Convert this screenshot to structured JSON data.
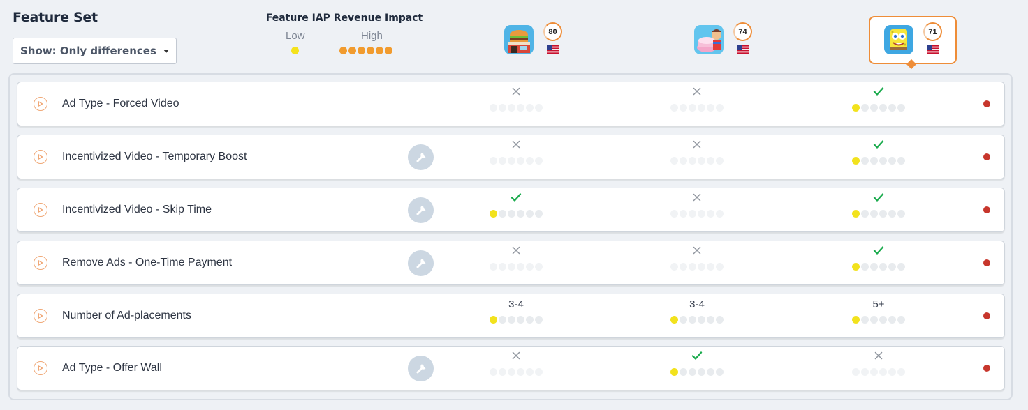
{
  "header": {
    "title": "Feature Set",
    "filter_label": "Show: Only differences"
  },
  "legend": {
    "title": "Feature IAP Revenue Impact",
    "low_label": "Low",
    "high_label": "High",
    "low_dots": 1,
    "high_dots": 6
  },
  "colors": {
    "accent_orange": "#ee8d38",
    "impact_yellow": "#f2e21d",
    "impact_orange": "#f19b2e",
    "check_green": "#1bab4e",
    "status_red": "#c7362c"
  },
  "apps": [
    {
      "icon": "burger-restaurant-app-icon",
      "score": "80",
      "country_flag": "us-flag-icon",
      "selected": false
    },
    {
      "icon": "cooking-cake-app-icon",
      "score": "74",
      "country_flag": "us-flag-icon",
      "selected": false
    },
    {
      "icon": "spongebob-app-icon",
      "score": "71",
      "country_flag": "us-flag-icon",
      "selected": true
    }
  ],
  "rows": [
    {
      "label": "Ad Type - Forced Video",
      "has_wrench": false,
      "cells": [
        {
          "type": "cross",
          "level": 0
        },
        {
          "type": "cross",
          "level": 0
        },
        {
          "type": "check",
          "level": 1
        }
      ]
    },
    {
      "label": "Incentivized Video - Temporary Boost",
      "has_wrench": true,
      "cells": [
        {
          "type": "cross",
          "level": 0
        },
        {
          "type": "cross",
          "level": 0
        },
        {
          "type": "check",
          "level": 1
        }
      ]
    },
    {
      "label": "Incentivized Video - Skip Time",
      "has_wrench": true,
      "cells": [
        {
          "type": "check",
          "level": 1
        },
        {
          "type": "cross",
          "level": 0
        },
        {
          "type": "check",
          "level": 1
        }
      ]
    },
    {
      "label": "Remove Ads - One-Time Payment",
      "has_wrench": true,
      "cells": [
        {
          "type": "cross",
          "level": 0
        },
        {
          "type": "cross",
          "level": 0
        },
        {
          "type": "check",
          "level": 1
        }
      ]
    },
    {
      "label": "Number of Ad-placements",
      "has_wrench": false,
      "cells": [
        {
          "type": "text",
          "text": "3-4",
          "level": 1
        },
        {
          "type": "text",
          "text": "3-4",
          "level": 1
        },
        {
          "type": "text",
          "text": "5+",
          "level": 1
        }
      ]
    },
    {
      "label": "Ad Type - Offer Wall",
      "has_wrench": true,
      "cells": [
        {
          "type": "cross",
          "level": 0
        },
        {
          "type": "check",
          "level": 1
        },
        {
          "type": "cross",
          "level": 0
        }
      ]
    }
  ]
}
